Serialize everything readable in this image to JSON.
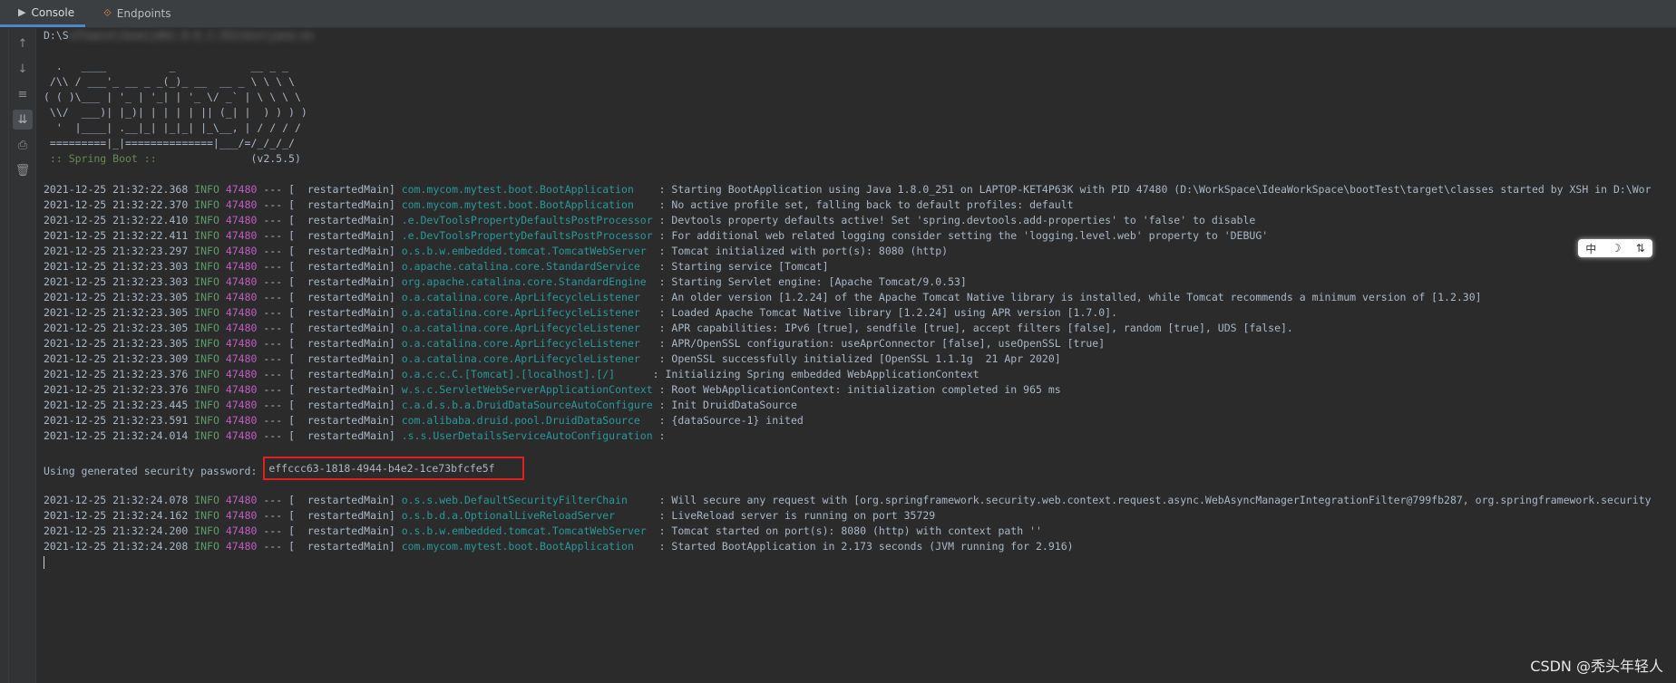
{
  "tabs": [
    {
      "icon": "console-icon",
      "label": "Console"
    },
    {
      "icon": "endpoints-icon",
      "label": "Endpoints"
    }
  ],
  "command_line": {
    "prefix": "D:\\S",
    "blurred": "oftware\\Java\\jdk1.8.0_",
    "suffix": "2.251\\bin\\java.ex"
  },
  "banner": [
    "  .   ____          _            __ _ _",
    " /\\\\ / ___'_ __ _ _(_)_ __  __ _ \\ \\ \\ \\",
    "( ( )\\___ | '_ | '_| | '_ \\/ _` | \\ \\ \\ \\",
    " \\\\/  ___)| |_)| | | | | || (_| |  ) ) ) )",
    "  '  |____| .__|_| |_|_| |_\\__, | / / / /",
    " =========|_|==============|___/=/_/_/_/"
  ],
  "spring_label": " :: Spring Boot :: ",
  "spring_version": "              (v2.5.5)",
  "log_lines": [
    {
      "ts": "2021-12-25 21:32:22.368",
      "level": "INFO",
      "pid": "47480",
      "thread": " --- [  restartedMain] ",
      "logger": "com.mycom.mytest.boot.BootApplication    ",
      "msg": ": Starting BootApplication using Java 1.8.0_251 on LAPTOP-KET4P63K with PID 47480 (D:\\WorkSpace\\IdeaWorkSpace\\bootTest\\target\\classes started by XSH in D:\\Wor"
    },
    {
      "ts": "2021-12-25 21:32:22.370",
      "level": "INFO",
      "pid": "47480",
      "thread": " --- [  restartedMain] ",
      "logger": "com.mycom.mytest.boot.BootApplication    ",
      "msg": ": No active profile set, falling back to default profiles: default"
    },
    {
      "ts": "2021-12-25 21:32:22.410",
      "level": "INFO",
      "pid": "47480",
      "thread": " --- [  restartedMain] ",
      "logger": ".e.DevToolsPropertyDefaultsPostProcessor ",
      "msg": ": Devtools property defaults active! Set 'spring.devtools.add-properties' to 'false' to disable"
    },
    {
      "ts": "2021-12-25 21:32:22.411",
      "level": "INFO",
      "pid": "47480",
      "thread": " --- [  restartedMain] ",
      "logger": ".e.DevToolsPropertyDefaultsPostProcessor ",
      "msg": ": For additional web related logging consider setting the 'logging.level.web' property to 'DEBUG'"
    },
    {
      "ts": "2021-12-25 21:32:23.297",
      "level": "INFO",
      "pid": "47480",
      "thread": " --- [  restartedMain] ",
      "logger": "o.s.b.w.embedded.tomcat.TomcatWebServer  ",
      "msg": ": Tomcat initialized with port(s): 8080 (http)"
    },
    {
      "ts": "2021-12-25 21:32:23.303",
      "level": "INFO",
      "pid": "47480",
      "thread": " --- [  restartedMain] ",
      "logger": "o.apache.catalina.core.StandardService   ",
      "msg": ": Starting service [Tomcat]"
    },
    {
      "ts": "2021-12-25 21:32:23.303",
      "level": "INFO",
      "pid": "47480",
      "thread": " --- [  restartedMain] ",
      "logger": "org.apache.catalina.core.StandardEngine  ",
      "msg": ": Starting Servlet engine: [Apache Tomcat/9.0.53]"
    },
    {
      "ts": "2021-12-25 21:32:23.305",
      "level": "INFO",
      "pid": "47480",
      "thread": " --- [  restartedMain] ",
      "logger": "o.a.catalina.core.AprLifecycleListener   ",
      "msg": ": An older version [1.2.24] of the Apache Tomcat Native library is installed, while Tomcat recommends a minimum version of [1.2.30]"
    },
    {
      "ts": "2021-12-25 21:32:23.305",
      "level": "INFO",
      "pid": "47480",
      "thread": " --- [  restartedMain] ",
      "logger": "o.a.catalina.core.AprLifecycleListener   ",
      "msg": ": Loaded Apache Tomcat Native library [1.2.24] using APR version [1.7.0]."
    },
    {
      "ts": "2021-12-25 21:32:23.305",
      "level": "INFO",
      "pid": "47480",
      "thread": " --- [  restartedMain] ",
      "logger": "o.a.catalina.core.AprLifecycleListener   ",
      "msg": ": APR capabilities: IPv6 [true], sendfile [true], accept filters [false], random [true], UDS [false]."
    },
    {
      "ts": "2021-12-25 21:32:23.305",
      "level": "INFO",
      "pid": "47480",
      "thread": " --- [  restartedMain] ",
      "logger": "o.a.catalina.core.AprLifecycleListener   ",
      "msg": ": APR/OpenSSL configuration: useAprConnector [false], useOpenSSL [true]"
    },
    {
      "ts": "2021-12-25 21:32:23.309",
      "level": "INFO",
      "pid": "47480",
      "thread": " --- [  restartedMain] ",
      "logger": "o.a.catalina.core.AprLifecycleListener   ",
      "msg": ": OpenSSL successfully initialized [OpenSSL 1.1.1g  21 Apr 2020]"
    },
    {
      "ts": "2021-12-25 21:32:23.376",
      "level": "INFO",
      "pid": "47480",
      "thread": " --- [  restartedMain] ",
      "logger": "o.a.c.c.C.[Tomcat].[localhost].[/]      ",
      "msg": ": Initializing Spring embedded WebApplicationContext"
    },
    {
      "ts": "2021-12-25 21:32:23.376",
      "level": "INFO",
      "pid": "47480",
      "thread": " --- [  restartedMain] ",
      "logger": "w.s.c.ServletWebServerApplicationContext ",
      "msg": ": Root WebApplicationContext: initialization completed in 965 ms"
    },
    {
      "ts": "2021-12-25 21:32:23.445",
      "level": "INFO",
      "pid": "47480",
      "thread": " --- [  restartedMain] ",
      "logger": "c.a.d.s.b.a.DruidDataSourceAutoConfigure ",
      "msg": ": Init DruidDataSource"
    },
    {
      "ts": "2021-12-25 21:32:23.591",
      "level": "INFO",
      "pid": "47480",
      "thread": " --- [  restartedMain] ",
      "logger": "com.alibaba.druid.pool.DruidDataSource   ",
      "msg": ": {dataSource-1} inited"
    },
    {
      "ts": "2021-12-25 21:32:24.014",
      "level": "INFO",
      "pid": "47480",
      "thread": " --- [  restartedMain] ",
      "logger": ".s.s.UserDetailsServiceAutoConfiguration ",
      "msg": ":"
    }
  ],
  "password_label": "Using generated security password: ",
  "password_value": "effccc63-1818-4944-b4e2-1ce73bfcfe5f",
  "log_lines_after": [
    {
      "ts": "2021-12-25 21:32:24.078",
      "level": "INFO",
      "pid": "47480",
      "thread": " --- [  restartedMain] ",
      "logger": "o.s.s.web.DefaultSecurityFilterChain     ",
      "msg": ": Will secure any request with [org.springframework.security.web.context.request.async.WebAsyncManagerIntegrationFilter@799fb287, org.springframework.security"
    },
    {
      "ts": "2021-12-25 21:32:24.162",
      "level": "INFO",
      "pid": "47480",
      "thread": " --- [  restartedMain] ",
      "logger": "o.s.b.d.a.OptionalLiveReloadServer       ",
      "msg": ": LiveReload server is running on port 35729"
    },
    {
      "ts": "2021-12-25 21:32:24.200",
      "level": "INFO",
      "pid": "47480",
      "thread": " --- [  restartedMain] ",
      "logger": "o.s.b.w.embedded.tomcat.TomcatWebServer  ",
      "msg": ": Tomcat started on port(s): 8080 (http) with context path ''"
    },
    {
      "ts": "2021-12-25 21:32:24.208",
      "level": "INFO",
      "pid": "47480",
      "thread": " --- [  restartedMain] ",
      "logger": "com.mycom.mytest.boot.BootApplication    ",
      "msg": ": Started BootApplication in 2.173 seconds (JVM running for 2.916)"
    }
  ],
  "ime_widget": {
    "chars": [
      "中",
      "☽",
      "⇅"
    ]
  },
  "watermark": "CSDN @秃头年轻人",
  "colors": {
    "level": "#5c9b69",
    "pid": "#c05ec2",
    "logger": "#299999",
    "highlight_border": "#e0201d"
  }
}
